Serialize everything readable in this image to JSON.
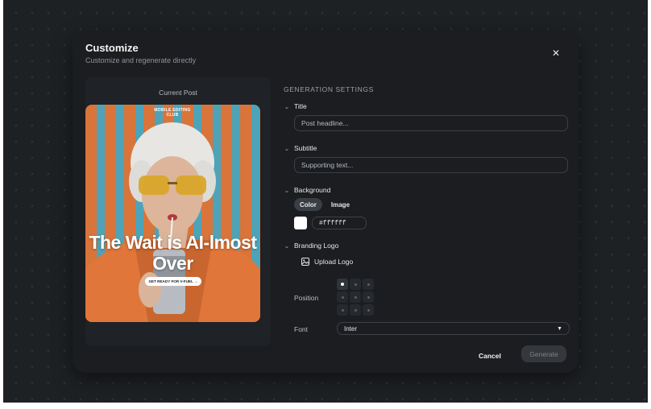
{
  "dialog": {
    "title": "Customize",
    "subtitle": "Customize and regenerate directly",
    "close_icon": "close-icon"
  },
  "preview": {
    "label": "Current Post",
    "brand": "MOBILE EDITING CLUB",
    "headline": "The Wait is AI-lmost Over",
    "cta": "GET READY FOR V-FUEL →",
    "colors": {
      "stripe_orange": "#d9743a",
      "stripe_blue": "#4fa3b8",
      "jacket": "#e0763a"
    }
  },
  "settings": {
    "header": "GENERATION SETTINGS",
    "title": {
      "label": "Title",
      "placeholder": "Post headline..."
    },
    "subtitle": {
      "label": "Subtitle",
      "placeholder": "Supporting text..."
    },
    "background": {
      "label": "Background",
      "options": [
        "Color",
        "Image"
      ],
      "selected": "Color",
      "color_value": "#ffffff"
    },
    "branding": {
      "label": "Branding Logo",
      "upload_label": "Upload Logo",
      "upload_icon": "image-icon",
      "position_label": "Position",
      "position_selected": "top-left"
    },
    "font": {
      "label": "Font",
      "value": "Inter",
      "icon": "caret-down-icon"
    }
  },
  "footer": {
    "cancel_label": "Cancel",
    "generate_label": "Generate"
  },
  "colors": {
    "backdrop": "#1e2124",
    "dialog": "#1b1d20",
    "text_primary": "#f2f3f4",
    "text_muted": "#8e9399"
  }
}
